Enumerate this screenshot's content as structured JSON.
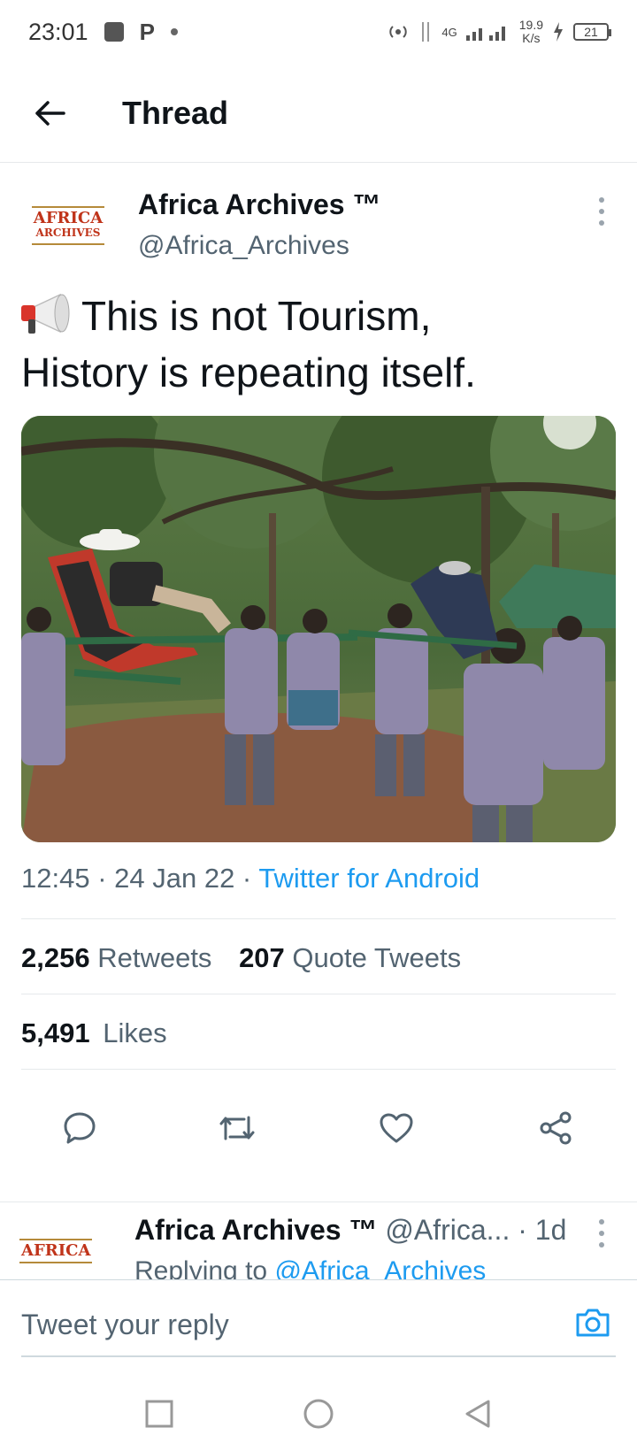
{
  "status_bar": {
    "time": "23:01",
    "network": "4G",
    "speed_value": "19.9",
    "speed_unit": "K/s",
    "battery": "21"
  },
  "header": {
    "title": "Thread"
  },
  "tweet": {
    "author": {
      "name": "Africa Archives ™",
      "handle": "@Africa_Archives",
      "avatar_text_line1": "AFRICA",
      "avatar_text_line2": "ARCHIVES"
    },
    "text_line1": "This is not Tourism,",
    "text_line2": "History is repeating itself.",
    "time": "12:45",
    "date": "24 Jan 22",
    "source": "Twitter for Android",
    "retweets_count": "2,256",
    "retweets_label": "Retweets",
    "quotes_count": "207",
    "quotes_label": "Quote Tweets",
    "likes_count": "5,491",
    "likes_label": "Likes"
  },
  "reply": {
    "name": "Africa Archives ™",
    "handle": "@Africa...",
    "age": "· 1d",
    "replying_prefix": "Replying to",
    "replying_to": "@Africa_Archives"
  },
  "compose": {
    "placeholder": "Tweet your reply"
  },
  "colors": {
    "accent": "#1d9bf0",
    "text_primary": "#0f1419",
    "text_secondary": "#536471"
  }
}
